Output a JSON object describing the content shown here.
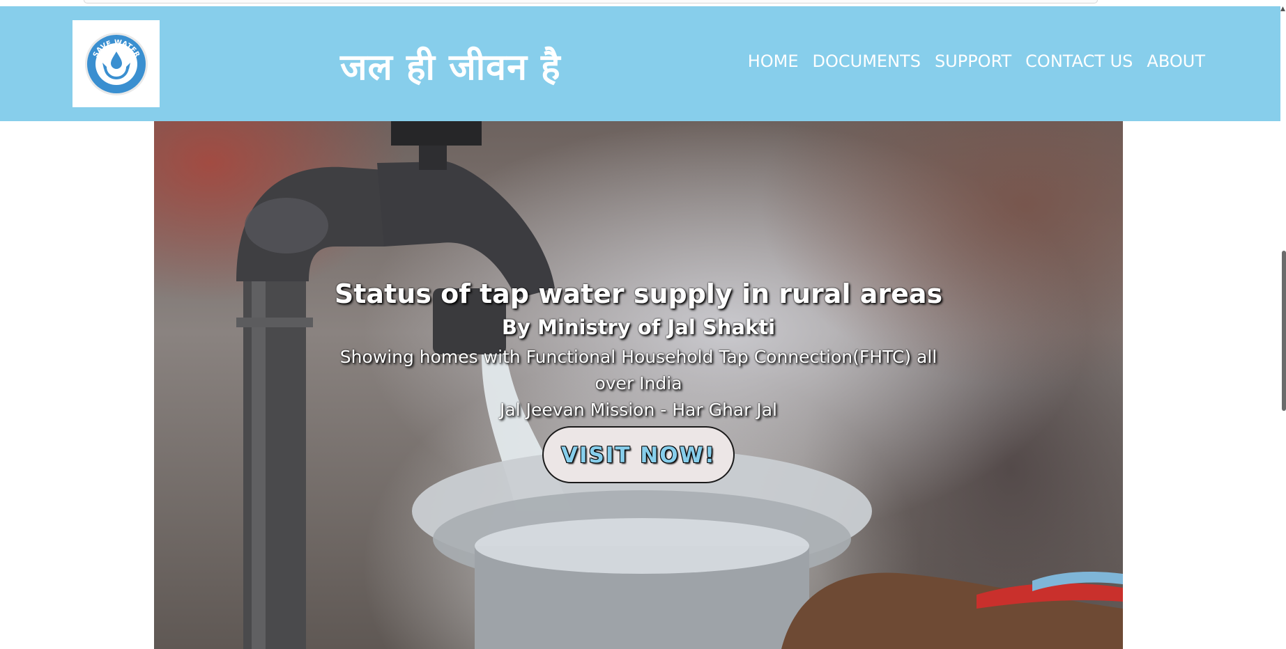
{
  "header": {
    "logo_alt": "SAVE WATER",
    "logo_text": "SAVE WATER",
    "title": "जल ही जीवन है",
    "nav": [
      {
        "label": "HOME"
      },
      {
        "label": "DOCUMENTS"
      },
      {
        "label": "SUPPORT"
      },
      {
        "label": "CONTACT US"
      },
      {
        "label": "ABOUT"
      }
    ]
  },
  "hero": {
    "title": "Status of tap water supply in rural areas",
    "subtitle": "By Ministry of Jal Shakti",
    "description": "Showing homes with Functional Household Tap Connection(FHTC) all over India",
    "mission": "Jal Jeevan Mission - Har Ghar Jal",
    "button_label": "VISIT NOW!"
  },
  "colors": {
    "navbar": "#87ceeb",
    "button_text": "#87ceeb",
    "logo_blue": "#3a8fd0"
  },
  "icons": {
    "logo": "water-drop-hands-icon"
  }
}
